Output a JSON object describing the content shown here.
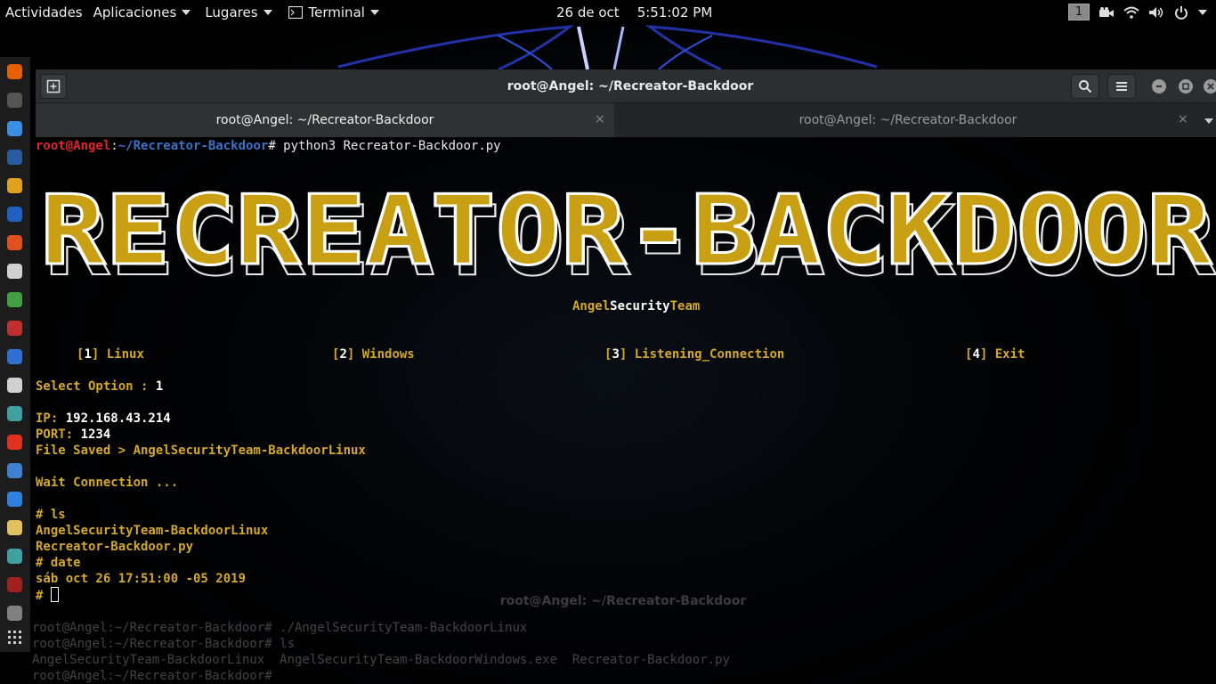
{
  "top_panel": {
    "activities": "Actividades",
    "applications": "Aplicaciones",
    "places": "Lugares",
    "terminal_menu": "Terminal",
    "date": "26 de oct",
    "time": "5:51:02 PM",
    "workspace": "1"
  },
  "dock": {
    "icons": [
      "firefox-icon",
      "terminal-icon",
      "files-icon",
      "metasploit-icon",
      "burpsuite-icon",
      "armitage-icon",
      "app-icon",
      "app-icon",
      "app-icon",
      "app-icon",
      "app-icon",
      "app-icon",
      "app-icon",
      "app-icon",
      "app-icon",
      "text-editor-icon",
      "app-icon",
      "app-icon",
      "app-icon",
      "app-icon",
      "show-apps-icon"
    ],
    "colors": [
      "#e66000",
      "#555555",
      "#3a8ee6",
      "#2a5aa0",
      "#e0a020",
      "#2060c0",
      "#e05020",
      "#d0d0d0",
      "#40a040",
      "#c03030",
      "#3070d0",
      "#d0d0d0",
      "#40a0a0",
      "#e03020",
      "#4080d0",
      "#3080e0",
      "#e0c060",
      "#40a0a0",
      "#a02020",
      "#808080",
      "#cccccc"
    ]
  },
  "window": {
    "title": "root@Angel: ~/Recreator-Backdoor",
    "tabs": [
      {
        "label": "root@Angel: ~/Recreator-Backdoor",
        "active": true
      },
      {
        "label": "root@Angel: ~/Recreator-Backdoor",
        "active": false
      }
    ],
    "close_glyph": "×"
  },
  "terminal": {
    "prompt_user": "root@Angel",
    "prompt_path": "~/Recreator-Backdoor",
    "prompt_sep": ":",
    "prompt_hash": "#",
    "command": " python3 Recreator-Backdoor.py",
    "banner_text": "RECREATOR-BACKDOOR",
    "team_part1": "Angel",
    "team_part2": "Security",
    "team_part3": "Team",
    "menu": [
      {
        "num": "1",
        "label": "Linux"
      },
      {
        "num": "2",
        "label": "Windows"
      },
      {
        "num": "3",
        "label": "Listening_Connection"
      },
      {
        "num": "4",
        "label": "Exit"
      }
    ],
    "select_label": "Select Option : ",
    "select_value": "1",
    "ip_label": "IP: ",
    "ip_value": "192.168.43.214",
    "port_label": "PORT: ",
    "port_value": "1234",
    "file_saved": "File Saved > AngelSecurityTeam-BackdoorLinux",
    "wait": "Wait Connection ...",
    "ls_cmd": "# ls",
    "ls_out1": "AngelSecurityTeam-BackdoorLinux",
    "ls_out2": "Recreator-Backdoor.py",
    "date_cmd": "# date",
    "date_out": "sáb oct 26 17:51:00 -05 2019",
    "final_prompt": "# "
  },
  "ghost_window": {
    "title": "root@Angel: ~/Recreator-Backdoor",
    "line1": "root@Angel:~/Recreator-Backdoor# ./AngelSecurityTeam-BackdoorLinux",
    "line2": "root@Angel:~/Recreator-Backdoor# ls",
    "line3": "AngelSecurityTeam-BackdoorLinux  AngelSecurityTeam-BackdoorWindows.exe  Recreator-Backdoor.py",
    "line4": "root@Angel:~/Recreator-Backdoor# "
  },
  "colors": {
    "accent_yellow": "#d4a82a",
    "prompt_red": "#e0252a",
    "path_blue": "#3a73c9"
  }
}
